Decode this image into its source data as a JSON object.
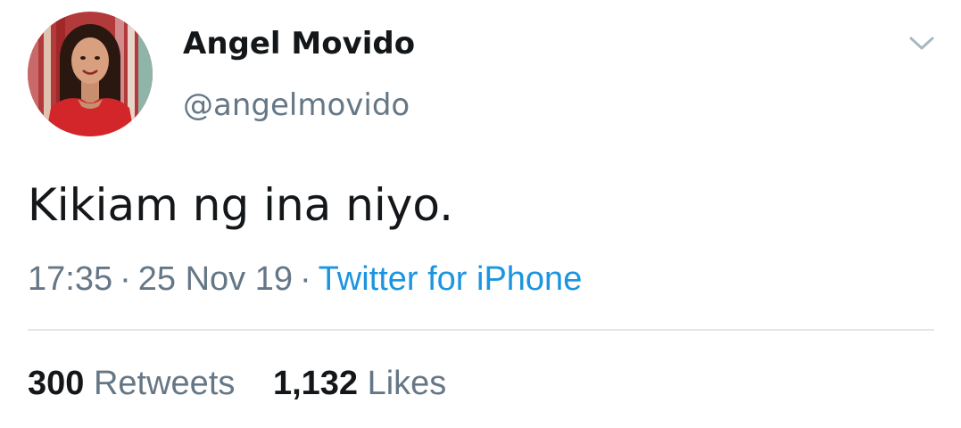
{
  "tweet": {
    "author": {
      "display_name": "Angel Movido",
      "handle": "@angelmovido",
      "avatar_icon": "profile-photo"
    },
    "menu_icon": "chevron-down-icon",
    "text": "Kikiam ng ina niyo.",
    "time": "17:35",
    "separator": "·",
    "date": "25 Nov 19",
    "source": "Twitter for iPhone",
    "stats": {
      "retweets_count": "300",
      "retweets_label": "Retweets",
      "likes_count": "1,132",
      "likes_label": "Likes"
    }
  },
  "colors": {
    "text_primary": "#14171a",
    "text_secondary": "#657786",
    "link": "#1b95e0",
    "divider": "#e1e8ed",
    "background": "#ffffff"
  }
}
